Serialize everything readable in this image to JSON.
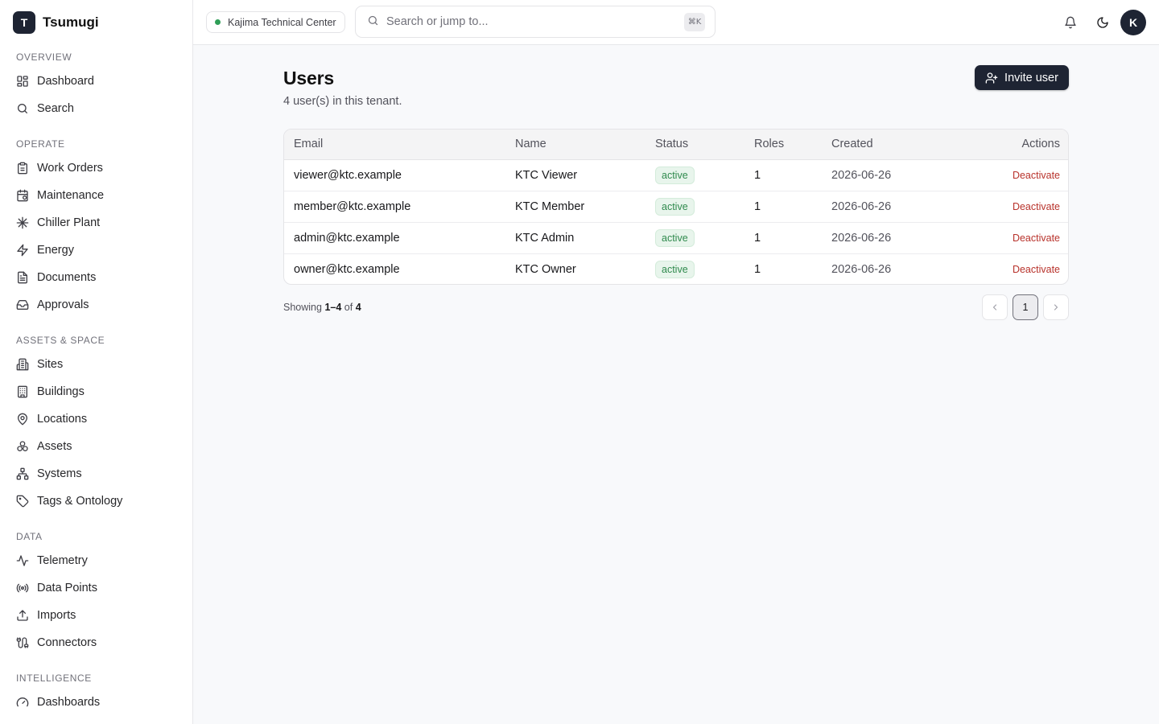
{
  "brand": {
    "logo_letter": "T",
    "name": "Tsumugi"
  },
  "sidebar": {
    "sections": [
      {
        "title": "OVERVIEW",
        "items": [
          {
            "label": "Dashboard",
            "icon": "dashboard-icon"
          },
          {
            "label": "Search",
            "icon": "search-icon"
          }
        ]
      },
      {
        "title": "OPERATE",
        "items": [
          {
            "label": "Work Orders",
            "icon": "clipboard-icon"
          },
          {
            "label": "Maintenance",
            "icon": "calendar-clock-icon"
          },
          {
            "label": "Chiller Plant",
            "icon": "snowflake-icon"
          },
          {
            "label": "Energy",
            "icon": "zap-icon"
          },
          {
            "label": "Documents",
            "icon": "file-text-icon"
          },
          {
            "label": "Approvals",
            "icon": "inbox-icon"
          }
        ]
      },
      {
        "title": "ASSETS & SPACE",
        "items": [
          {
            "label": "Sites",
            "icon": "building-icon"
          },
          {
            "label": "Buildings",
            "icon": "building-2-icon"
          },
          {
            "label": "Locations",
            "icon": "map-pin-icon"
          },
          {
            "label": "Assets",
            "icon": "boxes-icon"
          },
          {
            "label": "Systems",
            "icon": "network-icon"
          },
          {
            "label": "Tags & Ontology",
            "icon": "tag-icon"
          }
        ]
      },
      {
        "title": "DATA",
        "items": [
          {
            "label": "Telemetry",
            "icon": "activity-icon"
          },
          {
            "label": "Data Points",
            "icon": "radio-icon"
          },
          {
            "label": "Imports",
            "icon": "upload-icon"
          },
          {
            "label": "Connectors",
            "icon": "cable-icon"
          }
        ]
      },
      {
        "title": "INTELLIGENCE",
        "items": [
          {
            "label": "Dashboards",
            "icon": "gauge-icon"
          }
        ]
      }
    ]
  },
  "topbar": {
    "tenant": "Kajima Technical Center",
    "search_placeholder": "Search or jump to...",
    "search_shortcut": "⌘K",
    "avatar_letter": "K"
  },
  "main": {
    "title": "Users",
    "subtitle": "4 user(s) in this tenant.",
    "invite_label": "Invite user",
    "columns": [
      "Email",
      "Name",
      "Status",
      "Roles",
      "Created",
      "Actions"
    ],
    "rows": [
      {
        "email": "viewer@ktc.example",
        "name": "KTC Viewer",
        "status": "active",
        "roles": "1",
        "created": "2026-06-26",
        "action": "Deactivate"
      },
      {
        "email": "member@ktc.example",
        "name": "KTC Member",
        "status": "active",
        "roles": "1",
        "created": "2026-06-26",
        "action": "Deactivate"
      },
      {
        "email": "admin@ktc.example",
        "name": "KTC Admin",
        "status": "active",
        "roles": "1",
        "created": "2026-06-26",
        "action": "Deactivate"
      },
      {
        "email": "owner@ktc.example",
        "name": "KTC Owner",
        "status": "active",
        "roles": "1",
        "created": "2026-06-26",
        "action": "Deactivate"
      }
    ],
    "footer": {
      "showing_prefix": "Showing",
      "range": "1–4",
      "of": "of",
      "total": "4"
    },
    "pagination": {
      "current_page": "1"
    }
  },
  "colors": {
    "brand_dark": "#1e2433",
    "status_green": "#2f8a4d",
    "danger": "#b8322b"
  }
}
